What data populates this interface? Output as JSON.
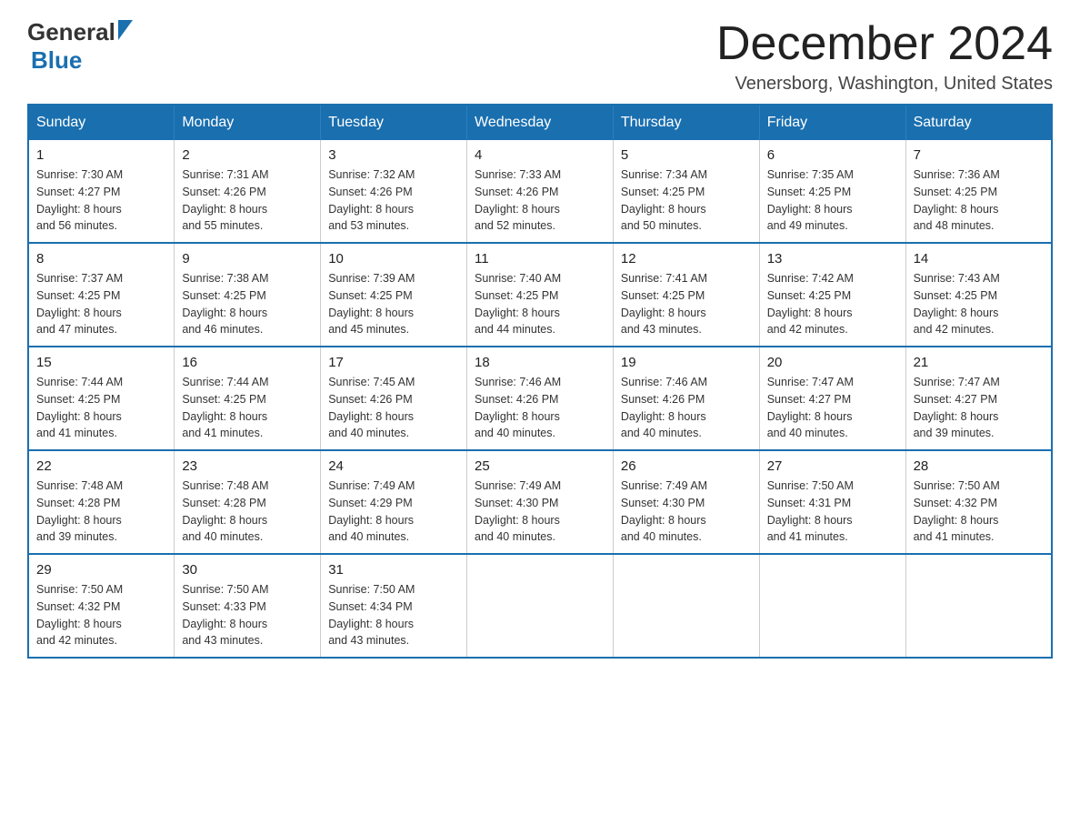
{
  "header": {
    "logo_general": "General",
    "logo_blue": "Blue",
    "month_title": "December 2024",
    "location": "Venersborg, Washington, United States"
  },
  "days_of_week": [
    "Sunday",
    "Monday",
    "Tuesday",
    "Wednesday",
    "Thursday",
    "Friday",
    "Saturday"
  ],
  "weeks": [
    [
      {
        "day": "1",
        "sunrise": "7:30 AM",
        "sunset": "4:27 PM",
        "daylight": "8 hours and 56 minutes."
      },
      {
        "day": "2",
        "sunrise": "7:31 AM",
        "sunset": "4:26 PM",
        "daylight": "8 hours and 55 minutes."
      },
      {
        "day": "3",
        "sunrise": "7:32 AM",
        "sunset": "4:26 PM",
        "daylight": "8 hours and 53 minutes."
      },
      {
        "day": "4",
        "sunrise": "7:33 AM",
        "sunset": "4:26 PM",
        "daylight": "8 hours and 52 minutes."
      },
      {
        "day": "5",
        "sunrise": "7:34 AM",
        "sunset": "4:25 PM",
        "daylight": "8 hours and 50 minutes."
      },
      {
        "day": "6",
        "sunrise": "7:35 AM",
        "sunset": "4:25 PM",
        "daylight": "8 hours and 49 minutes."
      },
      {
        "day": "7",
        "sunrise": "7:36 AM",
        "sunset": "4:25 PM",
        "daylight": "8 hours and 48 minutes."
      }
    ],
    [
      {
        "day": "8",
        "sunrise": "7:37 AM",
        "sunset": "4:25 PM",
        "daylight": "8 hours and 47 minutes."
      },
      {
        "day": "9",
        "sunrise": "7:38 AM",
        "sunset": "4:25 PM",
        "daylight": "8 hours and 46 minutes."
      },
      {
        "day": "10",
        "sunrise": "7:39 AM",
        "sunset": "4:25 PM",
        "daylight": "8 hours and 45 minutes."
      },
      {
        "day": "11",
        "sunrise": "7:40 AM",
        "sunset": "4:25 PM",
        "daylight": "8 hours and 44 minutes."
      },
      {
        "day": "12",
        "sunrise": "7:41 AM",
        "sunset": "4:25 PM",
        "daylight": "8 hours and 43 minutes."
      },
      {
        "day": "13",
        "sunrise": "7:42 AM",
        "sunset": "4:25 PM",
        "daylight": "8 hours and 42 minutes."
      },
      {
        "day": "14",
        "sunrise": "7:43 AM",
        "sunset": "4:25 PM",
        "daylight": "8 hours and 42 minutes."
      }
    ],
    [
      {
        "day": "15",
        "sunrise": "7:44 AM",
        "sunset": "4:25 PM",
        "daylight": "8 hours and 41 minutes."
      },
      {
        "day": "16",
        "sunrise": "7:44 AM",
        "sunset": "4:25 PM",
        "daylight": "8 hours and 41 minutes."
      },
      {
        "day": "17",
        "sunrise": "7:45 AM",
        "sunset": "4:26 PM",
        "daylight": "8 hours and 40 minutes."
      },
      {
        "day": "18",
        "sunrise": "7:46 AM",
        "sunset": "4:26 PM",
        "daylight": "8 hours and 40 minutes."
      },
      {
        "day": "19",
        "sunrise": "7:46 AM",
        "sunset": "4:26 PM",
        "daylight": "8 hours and 40 minutes."
      },
      {
        "day": "20",
        "sunrise": "7:47 AM",
        "sunset": "4:27 PM",
        "daylight": "8 hours and 40 minutes."
      },
      {
        "day": "21",
        "sunrise": "7:47 AM",
        "sunset": "4:27 PM",
        "daylight": "8 hours and 39 minutes."
      }
    ],
    [
      {
        "day": "22",
        "sunrise": "7:48 AM",
        "sunset": "4:28 PM",
        "daylight": "8 hours and 39 minutes."
      },
      {
        "day": "23",
        "sunrise": "7:48 AM",
        "sunset": "4:28 PM",
        "daylight": "8 hours and 40 minutes."
      },
      {
        "day": "24",
        "sunrise": "7:49 AM",
        "sunset": "4:29 PM",
        "daylight": "8 hours and 40 minutes."
      },
      {
        "day": "25",
        "sunrise": "7:49 AM",
        "sunset": "4:30 PM",
        "daylight": "8 hours and 40 minutes."
      },
      {
        "day": "26",
        "sunrise": "7:49 AM",
        "sunset": "4:30 PM",
        "daylight": "8 hours and 40 minutes."
      },
      {
        "day": "27",
        "sunrise": "7:50 AM",
        "sunset": "4:31 PM",
        "daylight": "8 hours and 41 minutes."
      },
      {
        "day": "28",
        "sunrise": "7:50 AM",
        "sunset": "4:32 PM",
        "daylight": "8 hours and 41 minutes."
      }
    ],
    [
      {
        "day": "29",
        "sunrise": "7:50 AM",
        "sunset": "4:32 PM",
        "daylight": "8 hours and 42 minutes."
      },
      {
        "day": "30",
        "sunrise": "7:50 AM",
        "sunset": "4:33 PM",
        "daylight": "8 hours and 43 minutes."
      },
      {
        "day": "31",
        "sunrise": "7:50 AM",
        "sunset": "4:34 PM",
        "daylight": "8 hours and 43 minutes."
      },
      null,
      null,
      null,
      null
    ]
  ],
  "labels": {
    "sunrise": "Sunrise:",
    "sunset": "Sunset:",
    "daylight": "Daylight:"
  },
  "colors": {
    "header_bg": "#1a6faf",
    "header_text": "#ffffff",
    "border": "#1a6faf"
  }
}
